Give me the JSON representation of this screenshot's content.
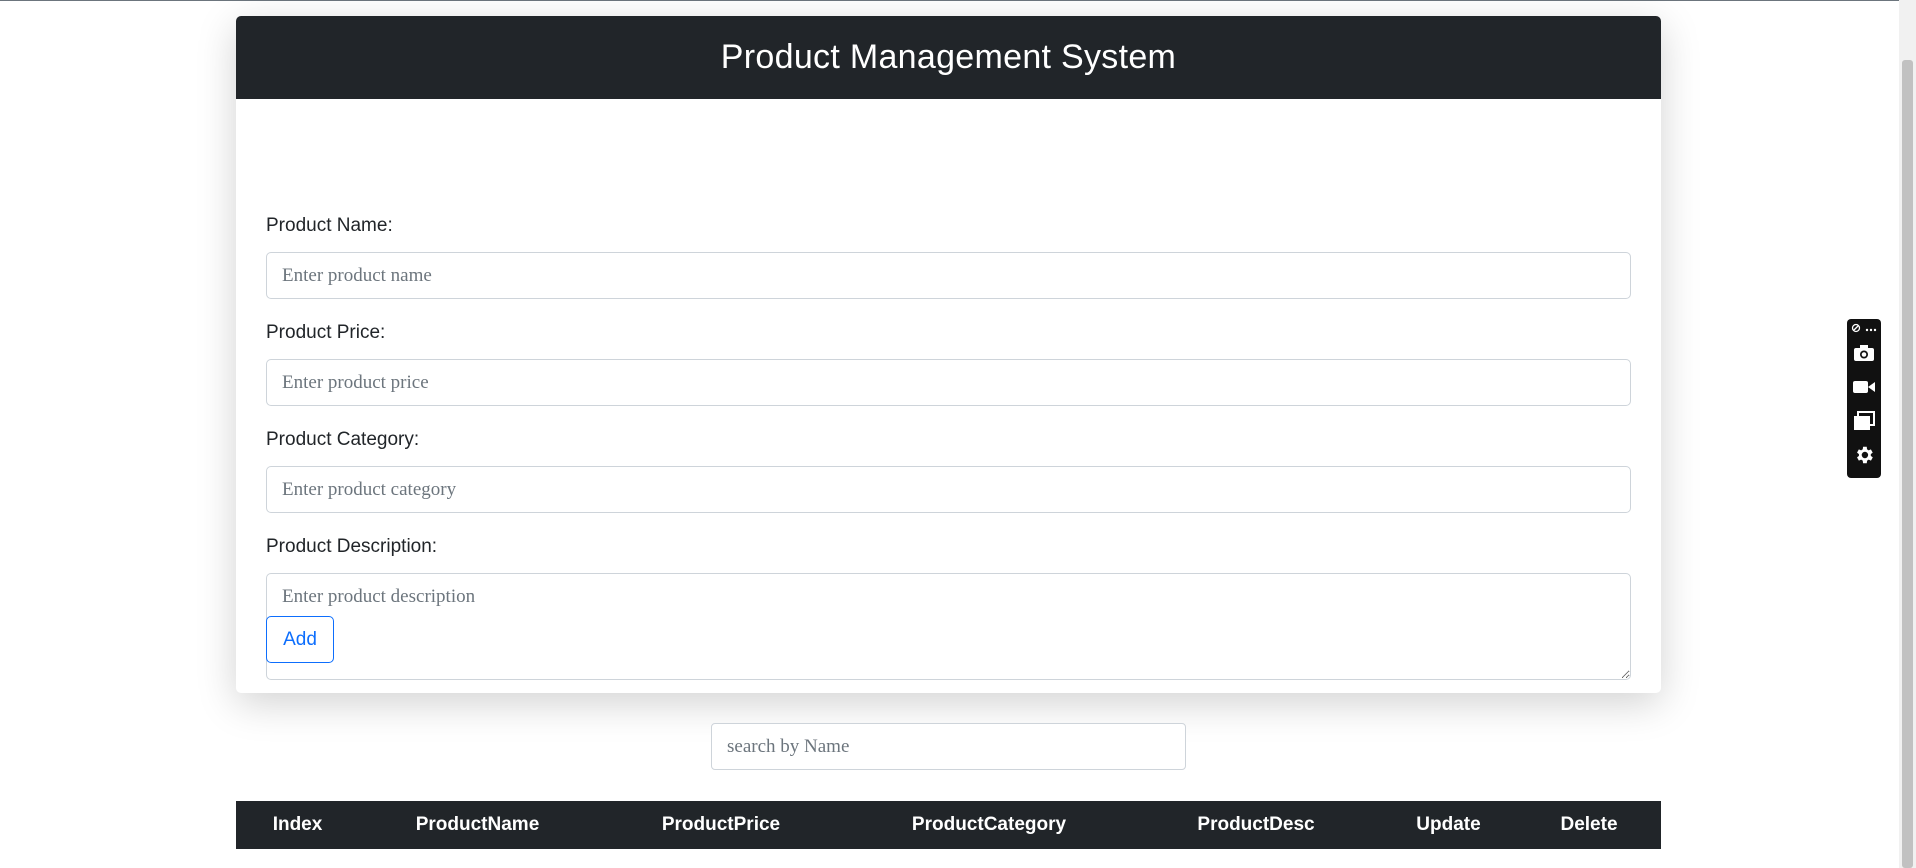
{
  "header": {
    "title": "Product Management System"
  },
  "form": {
    "name": {
      "label": "Product Name:",
      "placeholder": "Enter product name",
      "value": ""
    },
    "price": {
      "label": "Product Price:",
      "placeholder": "Enter product price",
      "value": ""
    },
    "category": {
      "label": "Product Category:",
      "placeholder": "Enter product category",
      "value": ""
    },
    "description": {
      "label": "Product Description:",
      "placeholder": "Enter product description",
      "value": ""
    },
    "add_label": "Add"
  },
  "search": {
    "placeholder": "search by Name",
    "value": ""
  },
  "table": {
    "columns": [
      "Index",
      "ProductName",
      "ProductPrice",
      "ProductCategory",
      "ProductDesc",
      "Update",
      "Delete"
    ]
  },
  "widget": {
    "icons": [
      "link-icon",
      "more-icon",
      "camera-icon",
      "video-icon",
      "windows-icon",
      "gear-icon"
    ]
  },
  "colors": {
    "header_bg": "#212529",
    "accent": "#0d6efd",
    "border": "#ced4da"
  }
}
